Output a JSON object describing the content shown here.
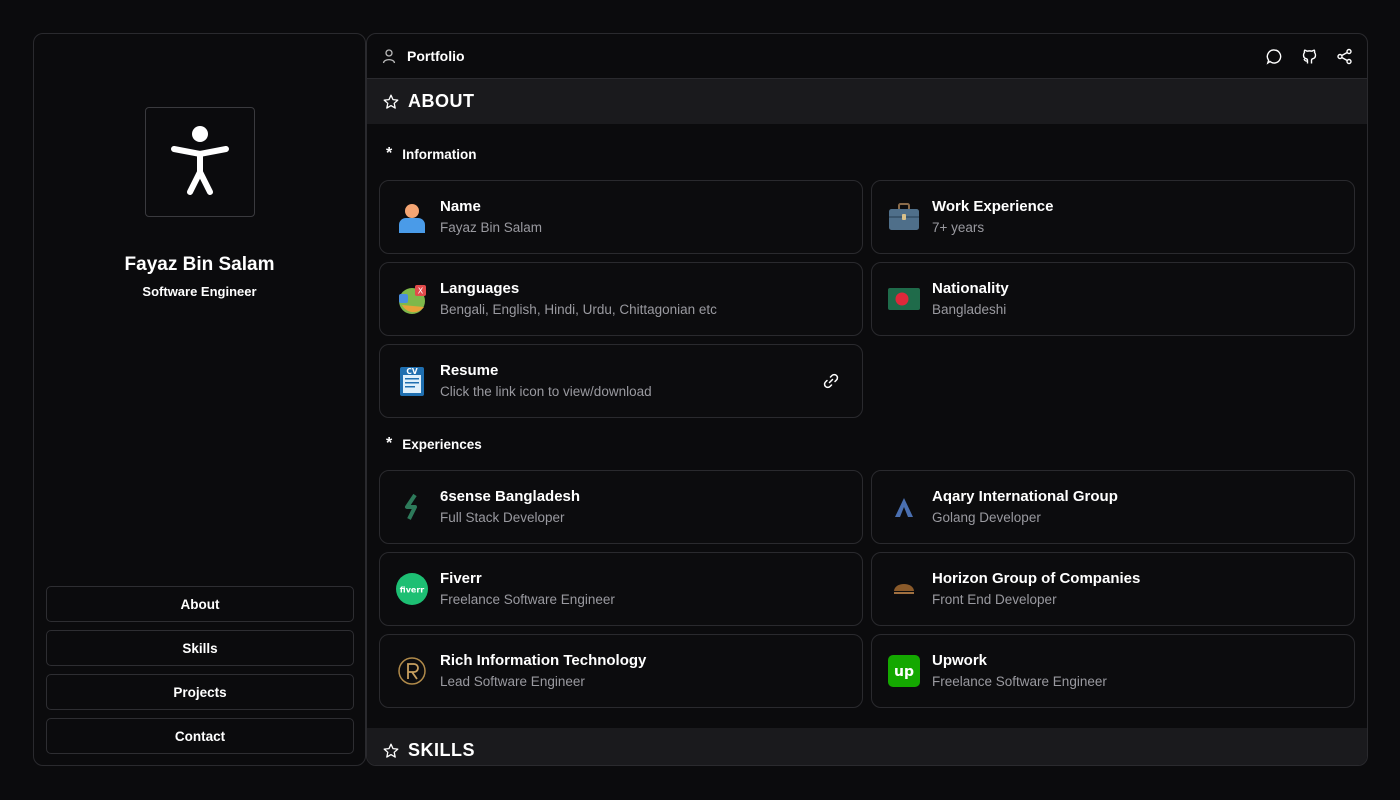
{
  "profile": {
    "name": "Fayaz Bin Salam",
    "role": "Software Engineer"
  },
  "nav": [
    "About",
    "Skills",
    "Projects",
    "Contact"
  ],
  "topbar": {
    "title": "Portfolio"
  },
  "sections": {
    "about": "ABOUT",
    "skills": "SKILLS"
  },
  "info": {
    "heading": "Information",
    "name": {
      "title": "Name",
      "value": "Fayaz Bin Salam"
    },
    "work": {
      "title": "Work Experience",
      "value": "7+ years"
    },
    "languages": {
      "title": "Languages",
      "value": "Bengali, English, Hindi, Urdu, Chittagonian etc"
    },
    "nationality": {
      "title": "Nationality",
      "value": "Bangladeshi"
    },
    "resume": {
      "title": "Resume",
      "value": "Click the link icon to view/download"
    }
  },
  "experiences": {
    "heading": "Experiences",
    "items": [
      {
        "company": "6sense Bangladesh",
        "role": "Full Stack Developer"
      },
      {
        "company": "Aqary International Group",
        "role": "Golang Developer"
      },
      {
        "company": "Fiverr",
        "role": "Freelance Software Engineer"
      },
      {
        "company": "Horizon Group of Companies",
        "role": "Front End Developer"
      },
      {
        "company": "Rich Information Technology",
        "role": "Lead Software Engineer"
      },
      {
        "company": "Upwork",
        "role": "Freelance Software Engineer"
      }
    ]
  },
  "logos": {
    "fiverr": "fiverr",
    "upwork": "up",
    "resume": "CV"
  },
  "colors": {
    "background": "#0b0b0d",
    "border": "#2a2a2e",
    "section": "#1a1a1d",
    "muted": "#9a9aa0"
  }
}
